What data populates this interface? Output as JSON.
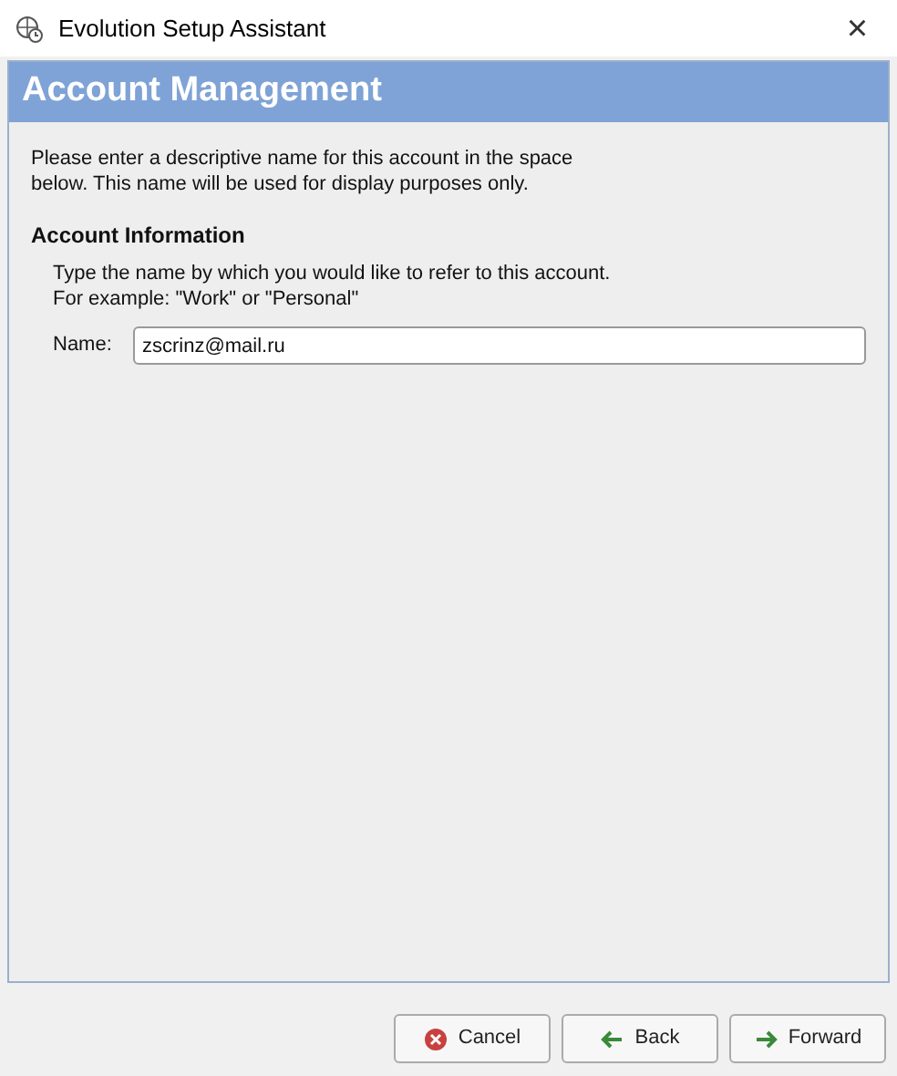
{
  "window": {
    "title": "Evolution Setup Assistant",
    "close": "×"
  },
  "header": {
    "title": "Account Management"
  },
  "intro": "Please enter a descriptive name for this account in the space below. This name will be used for display purposes only.",
  "section": {
    "title": "Account Information",
    "hint_lines": [
      "Type the name by which you would like to refer to this account.",
      "For example: \"Work\" or \"Personal\""
    ],
    "field": {
      "label": "Name:",
      "value": "zscrinz@mail.ru"
    }
  },
  "buttons": [
    {
      "label": "Cancel",
      "kind": "cancel"
    },
    {
      "label": "Back",
      "kind": "back"
    },
    {
      "label": "Forward",
      "kind": "forward"
    }
  ]
}
